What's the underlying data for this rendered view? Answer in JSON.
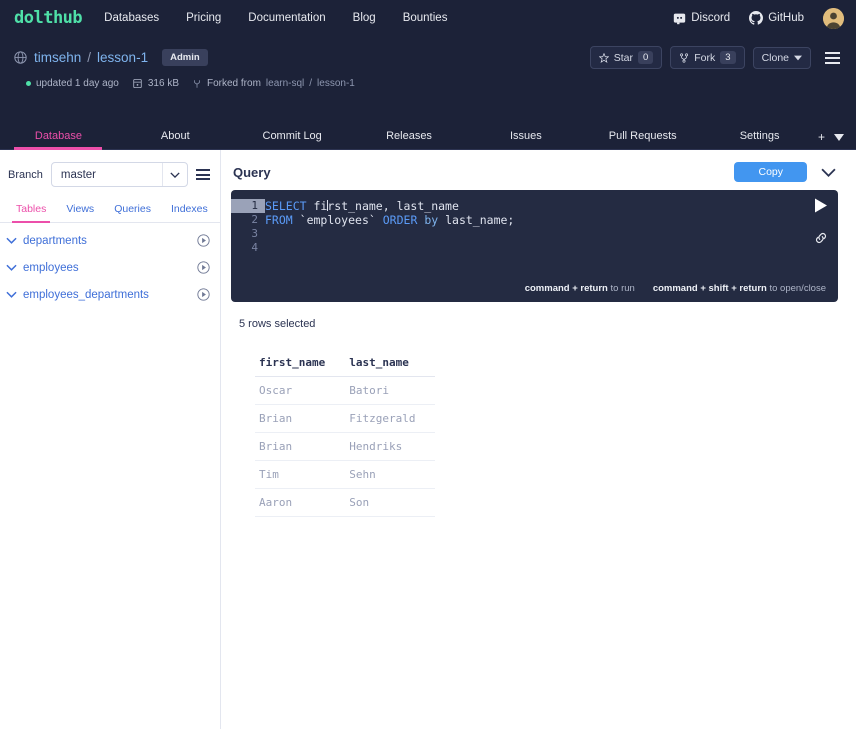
{
  "topnav": {
    "logo": "dolthub",
    "links": [
      "Databases",
      "Pricing",
      "Documentation",
      "Blog",
      "Bounties"
    ],
    "discord_label": "Discord",
    "github_label": "GitHub",
    "avatar_name": "user-avatar",
    "bg_color": "#1c2238",
    "logo_color": "#4fe0a8"
  },
  "repo": {
    "owner": "timsehn",
    "separator": "/",
    "name": "lesson-1",
    "role_badge": "Admin",
    "updated": "updated 1 day ago",
    "size": "316 kB",
    "forked_from_label": "Forked from",
    "forked_owner": "learn-sql",
    "forked_sep": "/",
    "forked_name": "lesson-1",
    "star_label": "Star",
    "star_count": "0",
    "fork_label": "Fork",
    "fork_count": "3",
    "clone_label": "Clone"
  },
  "tabs": {
    "items": [
      {
        "label": "Database",
        "active": true
      },
      {
        "label": "About",
        "active": false
      },
      {
        "label": "Commit Log",
        "active": false
      },
      {
        "label": "Releases",
        "active": false
      },
      {
        "label": "Issues",
        "active": false
      },
      {
        "label": "Pull Requests",
        "active": false
      },
      {
        "label": "Settings",
        "active": false
      }
    ],
    "add_label": "+",
    "active_color": "#ec4faa"
  },
  "sidebar": {
    "branch_label": "Branch",
    "branch_value": "master",
    "tabs": [
      {
        "label": "Tables",
        "active": true
      },
      {
        "label": "Views",
        "active": false
      },
      {
        "label": "Queries",
        "active": false
      },
      {
        "label": "Indexes",
        "active": false
      }
    ],
    "tables": [
      "departments",
      "employees",
      "employees_departments"
    ],
    "link_color": "#3f6fd8"
  },
  "query": {
    "title": "Query",
    "copy_label": "Copy",
    "lines": [
      {
        "num": "1",
        "current": true
      },
      {
        "num": "2",
        "current": false
      },
      {
        "num": "3",
        "current": false
      },
      {
        "num": "4",
        "current": false
      }
    ],
    "line1": {
      "kw": "SELECT",
      "text_a": "fi",
      "text_b": "rst_name, last_name"
    },
    "line2": {
      "kw1": "FROM",
      "tbl": "`employees`",
      "kw2": "ORDER",
      "kw3": "by",
      "col": "last_name;"
    },
    "hint_run_bold": "command + return",
    "hint_run_rest": " to run",
    "hint_open_bold": "command + shift + return",
    "hint_open_rest": " to open/close",
    "editor_bg": "#242b42"
  },
  "results": {
    "rows_selected": "5 rows selected",
    "columns": [
      "first_name",
      "last_name"
    ],
    "rows": [
      [
        "Oscar",
        "Batori"
      ],
      [
        "Brian",
        "Fitzgerald"
      ],
      [
        "Brian",
        "Hendriks"
      ],
      [
        "Tim",
        "Sehn"
      ],
      [
        "Aaron",
        "Son"
      ]
    ]
  }
}
